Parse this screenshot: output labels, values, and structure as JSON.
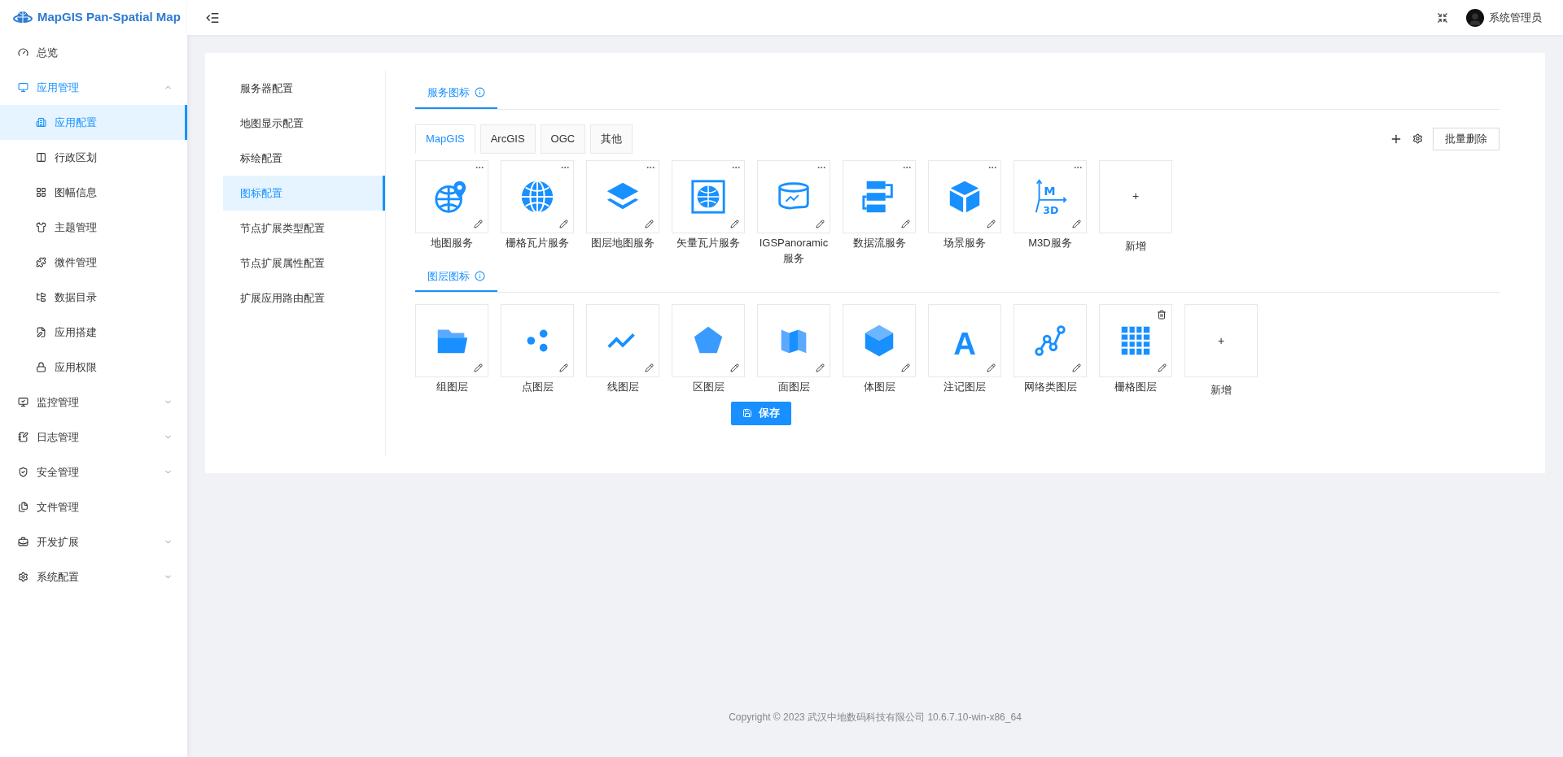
{
  "app": {
    "title": "MapGIS Pan-Spatial Map"
  },
  "header": {
    "user": "系统管理员"
  },
  "sidebar": {
    "items": [
      {
        "label": "总览",
        "selected": false
      },
      {
        "label": "应用管理",
        "selected": false,
        "expanded": true,
        "children": [
          {
            "label": "应用配置",
            "selected": true
          },
          {
            "label": "行政区划",
            "selected": false
          },
          {
            "label": "图幅信息",
            "selected": false
          },
          {
            "label": "主题管理",
            "selected": false
          },
          {
            "label": "微件管理",
            "selected": false
          },
          {
            "label": "数据目录",
            "selected": false
          },
          {
            "label": "应用搭建",
            "selected": false
          },
          {
            "label": "应用权限",
            "selected": false
          }
        ]
      },
      {
        "label": "监控管理",
        "selected": false,
        "expanded": false
      },
      {
        "label": "日志管理",
        "selected": false,
        "expanded": false
      },
      {
        "label": "安全管理",
        "selected": false,
        "expanded": false
      },
      {
        "label": "文件管理",
        "selected": false
      },
      {
        "label": "开发扩展",
        "selected": false,
        "expanded": false
      },
      {
        "label": "系统配置",
        "selected": false,
        "expanded": false
      }
    ]
  },
  "config_menu": {
    "items": [
      {
        "label": "服务器配置",
        "selected": false
      },
      {
        "label": "地图显示配置",
        "selected": false
      },
      {
        "label": "标绘配置",
        "selected": false
      },
      {
        "label": "图标配置",
        "selected": true
      },
      {
        "label": "节点扩展类型配置",
        "selected": false
      },
      {
        "label": "节点扩展属性配置",
        "selected": false
      },
      {
        "label": "扩展应用路由配置",
        "selected": false
      }
    ]
  },
  "service_icons": {
    "title": "服务图标",
    "tabs": [
      {
        "label": "MapGIS",
        "selected": true
      },
      {
        "label": "ArcGIS",
        "selected": false
      },
      {
        "label": "OGC",
        "selected": false
      },
      {
        "label": "其他",
        "selected": false
      }
    ],
    "batch_delete": "批量删除",
    "items": [
      {
        "label": "地图服务"
      },
      {
        "label": "栅格瓦片服务"
      },
      {
        "label": "图层地图服务"
      },
      {
        "label": "矢量瓦片服务"
      },
      {
        "label": "IGSPanoramic服务"
      },
      {
        "label": "数据流服务"
      },
      {
        "label": "场景服务"
      },
      {
        "label": "M3D服务",
        "icon_labels": [
          "M",
          "3D"
        ]
      }
    ],
    "add_label": "新增",
    "add_sign": "+"
  },
  "layer_icons": {
    "title": "图层图标",
    "items": [
      {
        "label": "组图层",
        "deletable": false
      },
      {
        "label": "点图层",
        "deletable": false
      },
      {
        "label": "线图层",
        "deletable": false
      },
      {
        "label": "区图层",
        "deletable": false
      },
      {
        "label": "面图层",
        "deletable": false
      },
      {
        "label": "体图层",
        "deletable": false
      },
      {
        "label": "注记图层",
        "deletable": false,
        "icon_labels": [
          "A"
        ]
      },
      {
        "label": "网络类图层",
        "deletable": false
      },
      {
        "label": "栅格图层",
        "deletable": true
      }
    ],
    "add_label": "新增",
    "add_sign": "+"
  },
  "save_button": "保存",
  "footer": "Copyright © 2023 武汉中地数码科技有限公司 10.6.7.10-win-x86_64"
}
